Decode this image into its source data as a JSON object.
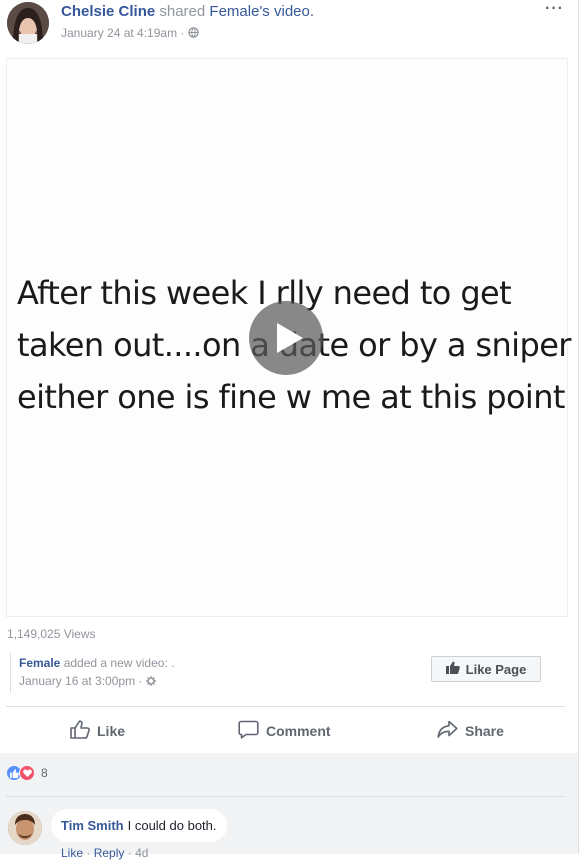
{
  "post": {
    "author": "Chelsie Cline",
    "shared_text": "shared",
    "shared_page": "Female's",
    "shared_object": "video.",
    "timestamp": "January 24 at 4:19am",
    "separator": "·",
    "more_label": "···"
  },
  "video": {
    "caption_lines": [
      "After this week I rlly need to get",
      "taken out....on a date or by a sniper",
      "either one is fine w me at this point"
    ],
    "views": "1,149,025 Views"
  },
  "shared_from": {
    "page_name": "Female",
    "action": "added a new video: .",
    "timestamp": "January 16 at 3:00pm",
    "separator": "·"
  },
  "like_page": {
    "label": "Like Page"
  },
  "actions": {
    "like": "Like",
    "comment": "Comment",
    "share": "Share"
  },
  "reactions": {
    "count": "8"
  },
  "comment": {
    "author": "Tim Smith",
    "text": "I could do both.",
    "like": "Like",
    "reply": "Reply",
    "time": "4d",
    "separator": "·"
  },
  "colors": {
    "link": "#365899",
    "meta": "#90949c",
    "like_blue": "#5890ff",
    "love_red": "#f25268"
  }
}
